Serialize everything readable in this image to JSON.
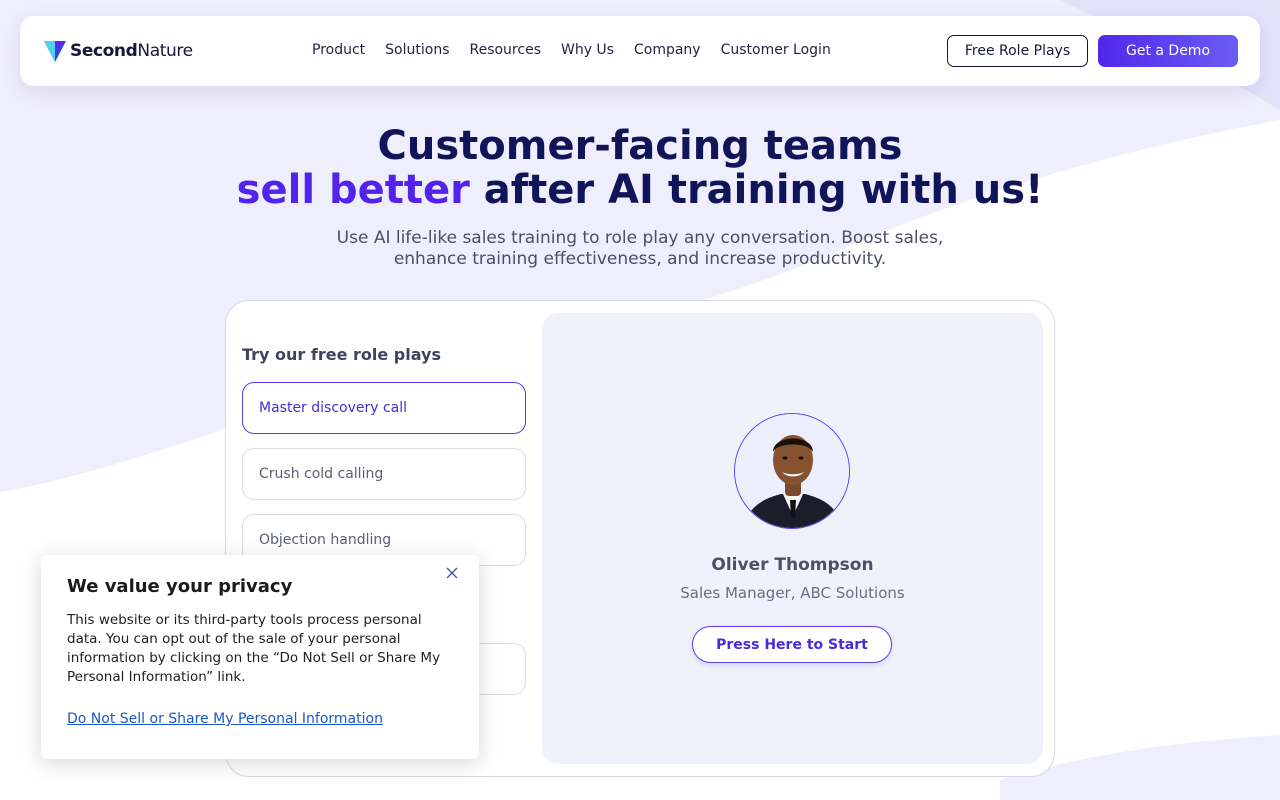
{
  "brand": {
    "name_bold": "Second",
    "name_light": "Nature"
  },
  "nav": [
    "Product",
    "Solutions",
    "Resources",
    "Why Us",
    "Company",
    "Customer Login"
  ],
  "header_buttons": {
    "free": "Free Role Plays",
    "demo": "Get a Demo"
  },
  "hero": {
    "line1": "Customer-facing teams",
    "line2_accent": "sell better",
    "line2_rest": " after AI training with us!",
    "subtitle": "Use AI life-like sales training to role play any conversation. Boost sales, enhance training effectiveness, and increase productivity."
  },
  "roleplays": {
    "heading": "Try our free role plays",
    "options": [
      "Master discovery call",
      "Crush cold calling",
      "Objection handling"
    ],
    "active_index": 0
  },
  "persona": {
    "name": "Oliver Thompson",
    "role": "Sales Manager, ABC Solutions",
    "start": "Press Here to Start"
  },
  "privacy": {
    "title": "We value your privacy",
    "body": "This website or its third-party tools process personal data. You can opt out of the sale of your personal information by clicking on the “Do Not Sell or Share My Personal Information” link.",
    "link": "Do Not Sell or Share My Personal Information"
  },
  "colors": {
    "accent": "#5123ed",
    "navy": "#12145a",
    "link": "#1a57c9"
  }
}
